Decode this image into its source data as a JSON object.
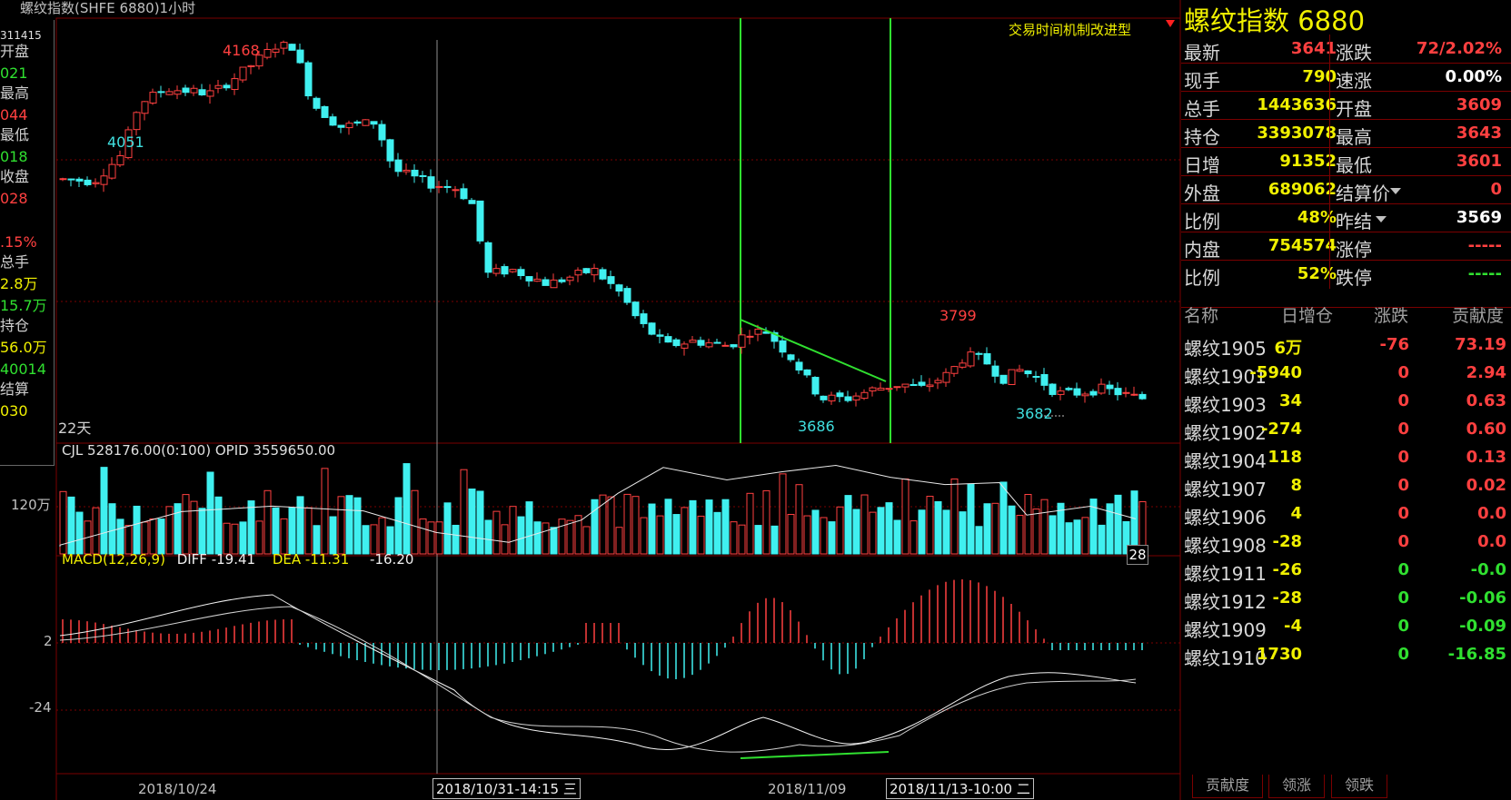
{
  "window": {
    "title": "螺纹指数(SHFE 6880)1小时"
  },
  "left_panel": {
    "lines": [
      "311415",
      "开盘",
      "021",
      "最高",
      "044",
      "最低",
      "018",
      "收盘",
      "028",
      "",
      ".15%",
      "总手",
      "2.8万",
      "15.7万",
      "持仓",
      "56.0万",
      "40014",
      "结算",
      "030"
    ]
  },
  "main_chart": {
    "notice": "交易时间机制改进型",
    "labels": {
      "high": "4168",
      "low_left": "4051",
      "low_mid": "3686",
      "peak_right": "3799",
      "low_right": "3682",
      "period": "22天"
    },
    "x_labels": [
      "2018/10/24",
      "2018/10/31-14:15 三",
      "2018/11/09",
      "2018/11/13-10:00 二"
    ]
  },
  "volume_panel": {
    "header": "CJL   528176.00(0:100)   OPID 3559650.00",
    "y_label": "120万",
    "right_box": "28"
  },
  "macd_panel": {
    "name": "MACD(12,26,9)",
    "diff": "DIFF -19.41",
    "dea": "DEA -11.31",
    "macd": "-16.20",
    "y_labels": [
      "2",
      "-24"
    ]
  },
  "quote": {
    "title": "螺纹指数  6880",
    "rows": [
      {
        "l1": "最新",
        "v1": "3641",
        "c1": "red",
        "l2": "涨跌",
        "v2": "72/2.02%",
        "c2": "red"
      },
      {
        "l1": "现手",
        "v1": "790",
        "c1": "yellow",
        "l2": "速涨",
        "v2": "0.00%",
        "c2": "white"
      },
      {
        "l1": "总手",
        "v1": "1443636",
        "c1": "yellow",
        "l2": "开盘",
        "v2": "3609",
        "c2": "red"
      },
      {
        "l1": "持仓",
        "v1": "3393078",
        "c1": "yellow",
        "l2": "最高",
        "v2": "3643",
        "c2": "red"
      },
      {
        "l1": "日增",
        "v1": "91352",
        "c1": "yellow",
        "l2": "最低",
        "v2": "3601",
        "c2": "red"
      },
      {
        "l1": "外盘",
        "v1": "689062",
        "c1": "yellow",
        "l2": "结算价",
        "v2": "0",
        "c2": "red"
      },
      {
        "l1": "比例",
        "v1": "48%",
        "c1": "yellow",
        "l2": "昨结",
        "v2": "3569",
        "c2": "white"
      },
      {
        "l1": "内盘",
        "v1": "754574",
        "c1": "yellow",
        "l2": "涨停",
        "v2": "-----",
        "c2": "red"
      },
      {
        "l1": "比例",
        "v1": "52%",
        "c1": "yellow",
        "l2": "跌停",
        "v2": "-----",
        "c2": "green"
      }
    ]
  },
  "contrib_table": {
    "headers": [
      "名称",
      "日增仓",
      "涨跌",
      "贡献度"
    ],
    "rows": [
      {
        "name": "螺纹1905",
        "oi": "6万",
        "chg": "-76",
        "chg_c": "red",
        "contrib": "73.19",
        "con_c": "red"
      },
      {
        "name": "螺纹1901",
        "oi": "-5940",
        "chg": "0",
        "chg_c": "red",
        "contrib": "2.94",
        "con_c": "red"
      },
      {
        "name": "螺纹1903",
        "oi": "34",
        "chg": "0",
        "chg_c": "red",
        "contrib": "0.63",
        "con_c": "red"
      },
      {
        "name": "螺纹1902",
        "oi": "-274",
        "chg": "0",
        "chg_c": "red",
        "contrib": "0.60",
        "con_c": "red"
      },
      {
        "name": "螺纹1904",
        "oi": "118",
        "chg": "0",
        "chg_c": "red",
        "contrib": "0.13",
        "con_c": "red"
      },
      {
        "name": "螺纹1907",
        "oi": "8",
        "chg": "0",
        "chg_c": "red",
        "contrib": "0.02",
        "con_c": "red"
      },
      {
        "name": "螺纹1906",
        "oi": "4",
        "chg": "0",
        "chg_c": "red",
        "contrib": "0.0",
        "con_c": "red"
      },
      {
        "name": "螺纹1908",
        "oi": "-28",
        "chg": "0",
        "chg_c": "red",
        "contrib": "0.0",
        "con_c": "red"
      },
      {
        "name": "螺纹1911",
        "oi": "-26",
        "chg": "0",
        "chg_c": "green",
        "contrib": "-0.0",
        "con_c": "green"
      },
      {
        "name": "螺纹1912",
        "oi": "-28",
        "chg": "0",
        "chg_c": "green",
        "contrib": "-0.06",
        "con_c": "green"
      },
      {
        "name": "螺纹1909",
        "oi": "-4",
        "chg": "0",
        "chg_c": "green",
        "contrib": "-0.09",
        "con_c": "green"
      },
      {
        "name": "螺纹1910",
        "oi": "1730",
        "chg": "0",
        "chg_c": "green",
        "contrib": "-16.85",
        "con_c": "green"
      }
    ],
    "tabs": [
      "贡献度",
      "领涨",
      "领跌"
    ]
  },
  "colors": {
    "up": "#ff4040",
    "down": "#40f0f0",
    "grid": "#7a0000",
    "vline": "#30e030"
  }
}
